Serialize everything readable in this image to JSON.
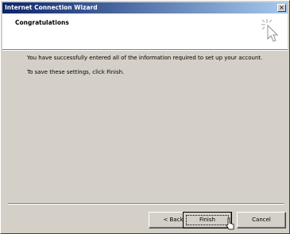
{
  "window": {
    "title": "Internet Connection Wizard"
  },
  "header": {
    "title": "Congratulations",
    "icon": "wizard-sparkle-cursor-icon"
  },
  "body": {
    "line1": "You have successfully entered all of the information required to set up your account.",
    "line2": "To save these settings, click Finish."
  },
  "buttons": {
    "back": "< Back",
    "finish": "Finish",
    "cancel": "Cancel",
    "close": "×"
  },
  "colors": {
    "titlebar_start": "#0a246a",
    "titlebar_end": "#a6caf0",
    "face": "#d4d0c8"
  }
}
